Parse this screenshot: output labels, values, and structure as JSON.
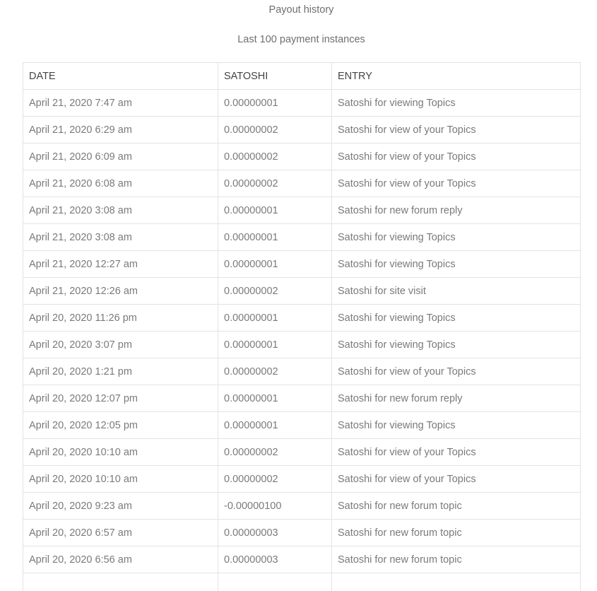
{
  "page": {
    "title": "Payout history",
    "subtitle": "Last 100 payment instances"
  },
  "table": {
    "columns": [
      "DATE",
      "SATOSHI",
      "ENTRY"
    ],
    "rows": [
      [
        "April 21, 2020 7:47 am",
        "0.00000001",
        "Satoshi for viewing Topics"
      ],
      [
        "April 21, 2020 6:29 am",
        "0.00000002",
        "Satoshi for view of your Topics"
      ],
      [
        "April 21, 2020 6:09 am",
        "0.00000002",
        "Satoshi for view of your Topics"
      ],
      [
        "April 21, 2020 6:08 am",
        "0.00000002",
        "Satoshi for view of your Topics"
      ],
      [
        "April 21, 2020 3:08 am",
        "0.00000001",
        "Satoshi for new forum reply"
      ],
      [
        "April 21, 2020 3:08 am",
        "0.00000001",
        "Satoshi for viewing Topics"
      ],
      [
        "April 21, 2020 12:27 am",
        "0.00000001",
        "Satoshi for viewing Topics"
      ],
      [
        "April 21, 2020 12:26 am",
        "0.00000002",
        "Satoshi for site visit"
      ],
      [
        "April 20, 2020 11:26 pm",
        "0.00000001",
        "Satoshi for viewing Topics"
      ],
      [
        "April 20, 2020 3:07 pm",
        "0.00000001",
        "Satoshi for viewing Topics"
      ],
      [
        "April 20, 2020 1:21 pm",
        "0.00000002",
        "Satoshi for view of your Topics"
      ],
      [
        "April 20, 2020 12:07 pm",
        "0.00000001",
        "Satoshi for new forum reply"
      ],
      [
        "April 20, 2020 12:05 pm",
        "0.00000001",
        "Satoshi for viewing Topics"
      ],
      [
        "April 20, 2020 10:10 am",
        "0.00000002",
        "Satoshi for view of your Topics"
      ],
      [
        "April 20, 2020 10:10 am",
        "0.00000002",
        "Satoshi for view of your Topics"
      ],
      [
        "April 20, 2020 9:23 am",
        "-0.00000100",
        "Satoshi for new forum topic"
      ],
      [
        "April 20, 2020 6:57 am",
        "0.00000003",
        "Satoshi for new forum topic"
      ],
      [
        "April 20, 2020 6:56 am",
        "0.00000003",
        "Satoshi for new forum topic"
      ],
      [
        "",
        "",
        ""
      ]
    ]
  }
}
